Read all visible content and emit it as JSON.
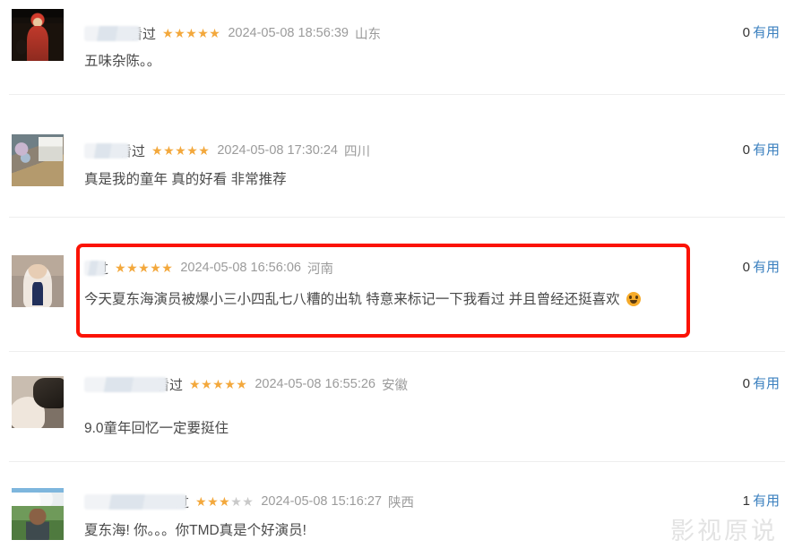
{
  "page": {
    "watermark": "影视原说",
    "useful_label": "有用",
    "watched_label": "看过"
  },
  "highlight": {
    "color": "#fb1305",
    "target_comment_index": 2
  },
  "comments": [
    {
      "username": "",
      "username_redacted": true,
      "redaction_width": 62,
      "watched": "看过",
      "rating": 5,
      "rating_max": 5,
      "timestamp": "2024-05-08 18:56:39",
      "region": "山东",
      "text": "五味杂陈。。",
      "has_emoji": false,
      "useful_count": "0",
      "useful_label": "有用",
      "avatar": "stage-red-costume-avatar"
    },
    {
      "username": "",
      "username_redacted": true,
      "redaction_width": 50,
      "watched": "看过",
      "rating": 5,
      "rating_max": 5,
      "timestamp": "2024-05-08 17:30:24",
      "region": "四川",
      "text": "真是我的童年 真的好看 非常推荐",
      "has_emoji": false,
      "useful_count": "0",
      "useful_label": "有用",
      "avatar": "indoor-scene-avatar"
    },
    {
      "username": "",
      "username_redacted": true,
      "redaction_width": 24,
      "watched": "过",
      "rating": 5,
      "rating_max": 5,
      "timestamp": "2024-05-08 16:56:06",
      "region": "河南",
      "text": "今天夏东海演员被爆小三小四乱七八糟的出轨 特意来标记一下我看过 并且曾经还挺喜欢",
      "has_emoji": true,
      "useful_count": "0",
      "useful_label": "有用",
      "avatar": "white-fur-portrait-avatar"
    },
    {
      "username": "",
      "username_redacted": true,
      "redaction_width": 92,
      "watched": "看过",
      "rating": 5,
      "rating_max": 5,
      "timestamp": "2024-05-08 16:55:26",
      "region": "安徽",
      "text": "9.0童年回忆一定要挺住",
      "has_emoji": false,
      "useful_count": "0",
      "useful_label": "有用",
      "avatar": "hand-object-avatar"
    },
    {
      "username": "",
      "username_redacted": true,
      "redaction_width": 114,
      "watched": "过",
      "rating": 3,
      "rating_max": 5,
      "timestamp": "2024-05-08 15:16:27",
      "region": "陕西",
      "text": "夏东海! 你。。。你TMD真是个好演员!",
      "has_emoji": false,
      "useful_count": "1",
      "useful_label": "有用",
      "avatar": "mountain-selfie-avatar"
    }
  ]
}
